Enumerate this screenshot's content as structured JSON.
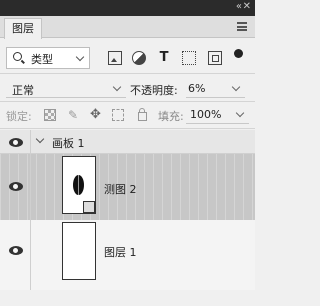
{
  "panel": {
    "tab_label": "图层"
  },
  "filter": {
    "kind_label": "类型",
    "icons": [
      "pixel-filter-icon",
      "adjustment-filter-icon",
      "type-filter-icon",
      "shape-filter-icon",
      "smart-object-filter-icon",
      "filter-toggle-icon"
    ],
    "type_icon_glyph": "T"
  },
  "blend": {
    "mode": "正常",
    "opacity_label": "不透明度:",
    "opacity_value": "6%"
  },
  "lock": {
    "label": "锁定:",
    "fill_label": "填充:",
    "fill_value": "100%"
  },
  "layers": [
    {
      "type": "group",
      "name": "画板 1",
      "visible": true,
      "expanded": true
    },
    {
      "type": "layer",
      "name": "测图 2",
      "visible": true,
      "selected": true
    },
    {
      "type": "layer",
      "name": "图层 1",
      "visible": true,
      "selected": false
    }
  ]
}
